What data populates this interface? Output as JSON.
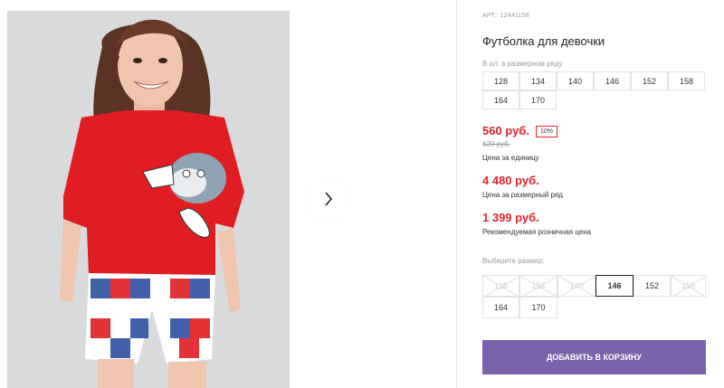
{
  "product": {
    "sku": "АРТ.: 12441158",
    "title": "Футболка для девочки",
    "image_alt": "girl-in-red-t-shirt-photo"
  },
  "size_range": {
    "label": "В шт. в размерном ряду",
    "sizes": [
      "128",
      "134",
      "140",
      "146",
      "152",
      "158",
      "164",
      "170"
    ]
  },
  "pricing": {
    "price": "560 руб.",
    "discount": "10%",
    "old_price": "620 руб.",
    "unit_label": "Цена за единицу",
    "row_price": "4 480 руб.",
    "row_label": "Цена за размерный ряд",
    "retail_price": "1 399 руб.",
    "retail_label": "Рекомендуемая розничная цена"
  },
  "size_select": {
    "label": "Выберите размер:",
    "options": [
      {
        "size": "128",
        "available": false
      },
      {
        "size": "134",
        "available": false
      },
      {
        "size": "140",
        "available": false
      },
      {
        "size": "146",
        "available": true,
        "selected": true
      },
      {
        "size": "152",
        "available": true
      },
      {
        "size": "158",
        "available": false
      },
      {
        "size": "164",
        "available": true
      },
      {
        "size": "170",
        "available": true
      }
    ]
  },
  "cart": {
    "button_label": "ДОБАВИТЬ В КОРЗИНУ"
  },
  "icons": {
    "next": "chevron-right-icon"
  },
  "colors": {
    "accent": "#e3242b",
    "button": "#7a63a8",
    "shirt": "#e01e22"
  }
}
